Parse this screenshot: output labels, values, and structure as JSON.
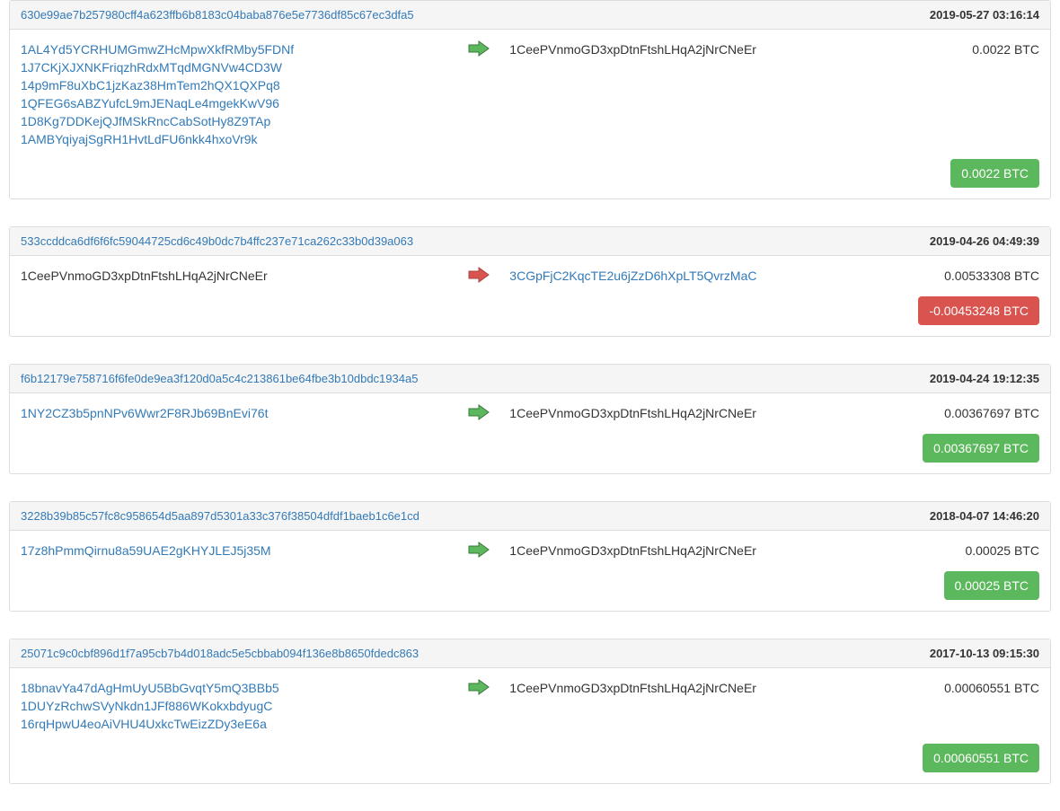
{
  "transactions": [
    {
      "hash": "630e99ae7b257980cff4a623ffb6b8183c04baba876e5e7736df85c67ec3dfa5",
      "timestamp": "2019-05-27 03:16:14",
      "arrow": "green",
      "inputs": [
        {
          "addr": "1AL4Yd5YCRHUMGmwZHcMpwXkfRMby5FDNf",
          "link": true
        },
        {
          "addr": "1J7CKjXJXNKFriqzhRdxMTqdMGNVw4CD3W",
          "link": true
        },
        {
          "addr": "14p9mF8uXbC1jzKaz38HmTem2hQX1QXPq8",
          "link": true
        },
        {
          "addr": "1QFEG6sABZYufcL9mJENaqLe4mgekKwV96",
          "link": true
        },
        {
          "addr": "1D8Kg7DDKejQJfMSkRncCabSotHy8Z9TAp",
          "link": true
        },
        {
          "addr": "1AMBYqiyajSgRH1HvtLdFU6nkk4hxoVr9k",
          "link": true
        }
      ],
      "outputs": [
        {
          "addr": "1CeePVnmoGD3xpDtnFtshLHqA2jNrCNeEr",
          "link": false,
          "amount": "0.0022 BTC"
        }
      ],
      "net_badge": {
        "text": "0.0022 BTC",
        "color": "green"
      }
    },
    {
      "hash": "533ccddca6df6f6fc59044725cd6c49b0dc7b4ffc237e71ca262c33b0d39a063",
      "timestamp": "2019-04-26 04:49:39",
      "arrow": "red",
      "inputs": [
        {
          "addr": "1CeePVnmoGD3xpDtnFtshLHqA2jNrCNeEr",
          "link": false
        }
      ],
      "outputs": [
        {
          "addr": "3CGpFjC2KqcTE2u6jZzD6hXpLT5QvrzMaC",
          "link": true,
          "amount": "0.00533308 BTC"
        }
      ],
      "net_badge": {
        "text": "-0.00453248 BTC",
        "color": "red"
      }
    },
    {
      "hash": "f6b12179e758716f6fe0de9ea3f120d0a5c4c213861be64fbe3b10dbdc1934a5",
      "timestamp": "2019-04-24 19:12:35",
      "arrow": "green",
      "inputs": [
        {
          "addr": "1NY2CZ3b5pnNPv6Wwr2F8RJb69BnEvi76t",
          "link": true
        }
      ],
      "outputs": [
        {
          "addr": "1CeePVnmoGD3xpDtnFtshLHqA2jNrCNeEr",
          "link": false,
          "amount": "0.00367697 BTC"
        }
      ],
      "net_badge": {
        "text": "0.00367697 BTC",
        "color": "green"
      }
    },
    {
      "hash": "3228b39b85c57fc8c958654d5aa897d5301a33c376f38504dfdf1baeb1c6e1cd",
      "timestamp": "2018-04-07 14:46:20",
      "arrow": "green",
      "inputs": [
        {
          "addr": "17z8hPmmQirnu8a59UAE2gKHYJLEJ5j35M",
          "link": true
        }
      ],
      "outputs": [
        {
          "addr": "1CeePVnmoGD3xpDtnFtshLHqA2jNrCNeEr",
          "link": false,
          "amount": "0.00025 BTC"
        }
      ],
      "net_badge": {
        "text": "0.00025 BTC",
        "color": "green"
      }
    },
    {
      "hash": "25071c9c0cbf896d1f7a95cb7b4d018adc5e5cbbab094f136e8b8650fdedc863",
      "timestamp": "2017-10-13 09:15:30",
      "arrow": "green",
      "inputs": [
        {
          "addr": "18bnavYa47dAgHmUyU5BbGvqtY5mQ3BBb5",
          "link": true
        },
        {
          "addr": "1DUYzRchwSVyNkdn1JFf886WKokxbdyugC",
          "link": true
        },
        {
          "addr": "16rqHpwU4eoAiVHU4UxkcTwEizZDy3eE6a",
          "link": true
        }
      ],
      "outputs": [
        {
          "addr": "1CeePVnmoGD3xpDtnFtshLHqA2jNrCNeEr",
          "link": false,
          "amount": "0.00060551 BTC"
        }
      ],
      "net_badge": {
        "text": "0.00060551 BTC",
        "color": "green"
      }
    }
  ]
}
